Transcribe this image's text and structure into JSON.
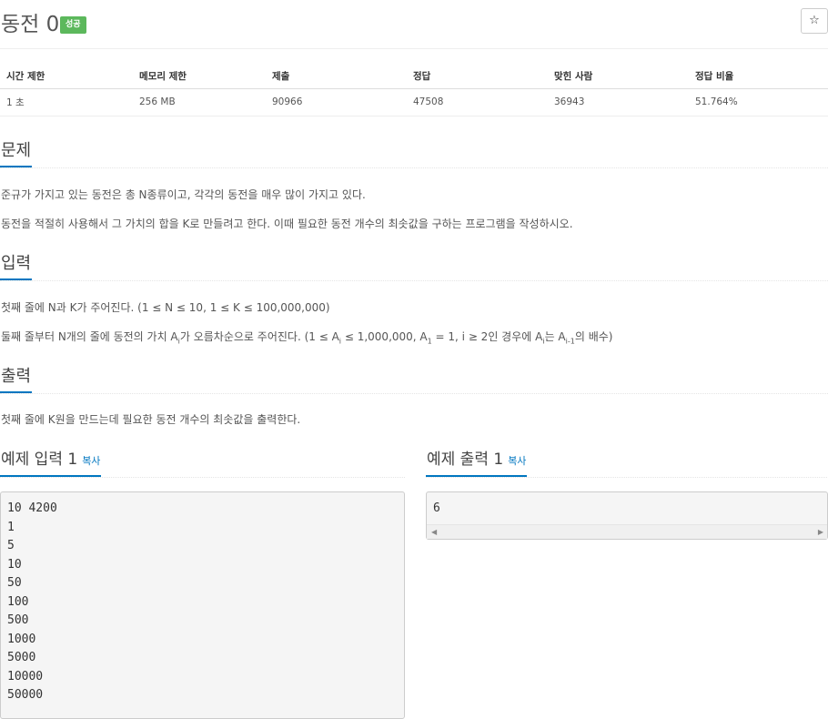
{
  "problem": {
    "title": "동전 0",
    "badge": "성공",
    "star": "☆"
  },
  "info": {
    "headers": [
      "시간 제한",
      "메모리 제한",
      "제출",
      "정답",
      "맞힌 사람",
      "정답 비율"
    ],
    "values": [
      "1 초",
      "256 MB",
      "90966",
      "47508",
      "36943",
      "51.764%"
    ]
  },
  "sections": {
    "description": {
      "title": "문제",
      "lines": [
        "준규가 가지고 있는 동전은 총 N종류이고, 각각의 동전을 매우 많이 가지고 있다.",
        "동전을 적절히 사용해서 그 가치의 합을 K로 만들려고 한다. 이때 필요한 동전 개수의 최솟값을 구하는 프로그램을 작성하시오."
      ]
    },
    "input": {
      "title": "입력",
      "line1": "첫째 줄에 N과 K가 주어진다. (1 ≤ N ≤ 10, 1 ≤ K ≤ 100,000,000)",
      "line2_a": "둘째 줄부터 N개의 줄에 동전의 가치 A",
      "line2_sub1": "i",
      "line2_b": "가 오름차순으로 주어진다. (1 ≤ A",
      "line2_sub2": "i",
      "line2_c": " ≤ 1,000,000, A",
      "line2_sub3": "1",
      "line2_d": " = 1, i ≥ 2인 경우에 A",
      "line2_sub4": "i",
      "line2_e": "는 A",
      "line2_sub5": "i-1",
      "line2_f": "의 배수)"
    },
    "output": {
      "title": "출력",
      "line": "첫째 줄에 K원을 만드는데 필요한 동전 개수의 최솟값을 출력한다."
    }
  },
  "samples": {
    "input_title": "예제 입력 1",
    "output_title": "예제 출력 1",
    "copy_label": "복사",
    "input_text": "10 4200\n1\n5\n10\n50\n100\n500\n1000\n5000\n10000\n50000",
    "output_text": "6"
  }
}
